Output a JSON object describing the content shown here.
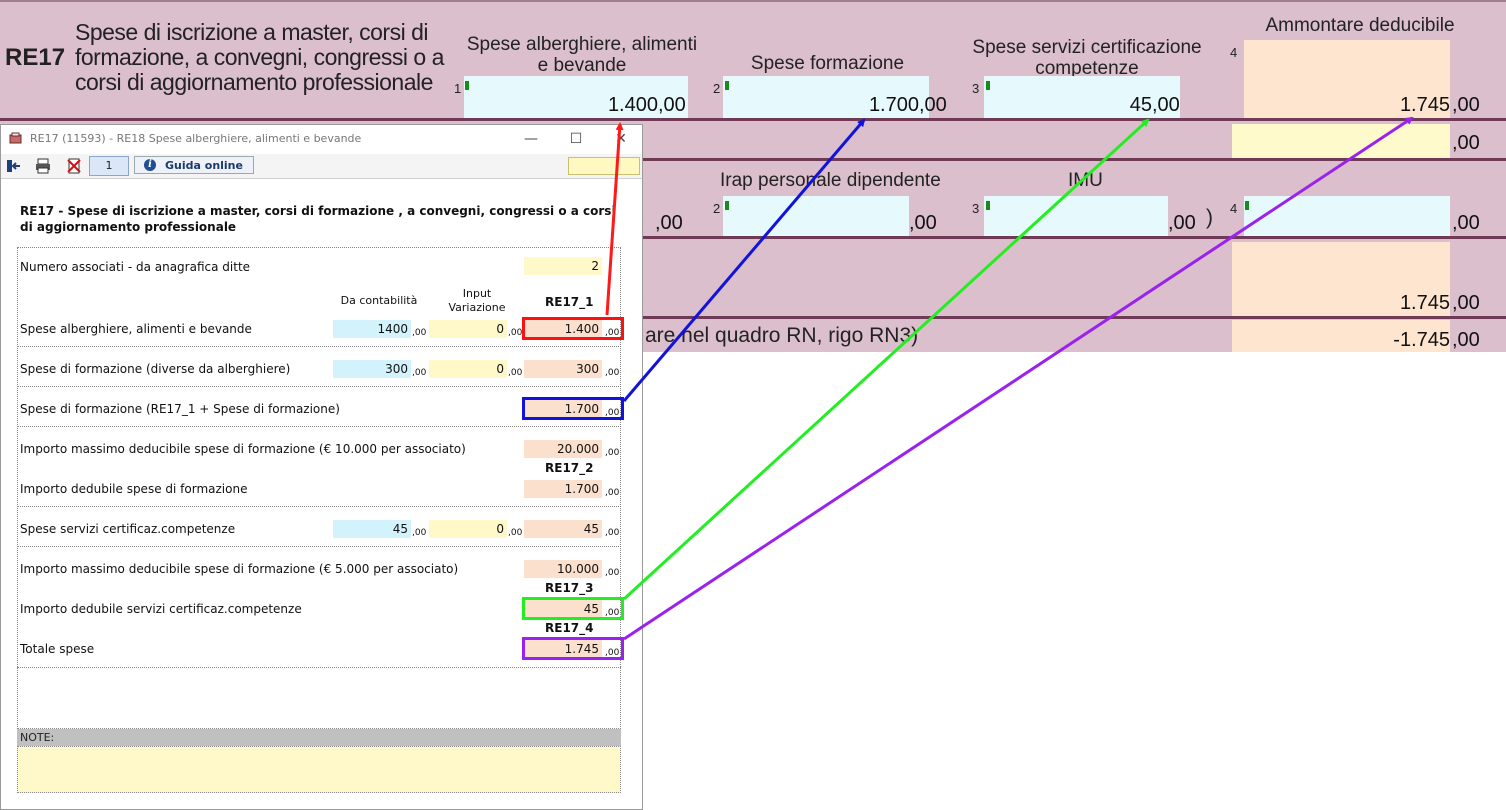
{
  "form": {
    "row_code": "RE17",
    "row_desc": "Spese di iscrizione a master, corsi di formazione, a convegni, congressi o a corsi di aggiornamento professionale",
    "col1_head": "Spese alberghiere, alimenti e bevande",
    "col2_head": "Spese formazione",
    "col3_head": "Spese servizi certificazione competenze",
    "col4_head": "Ammontare deducibile",
    "f1_num": "1",
    "f1_val": "1.400",
    "f1_dec": ",00",
    "f2_num": "2",
    "f2_val": "1.700",
    "f2_dec": ",00",
    "f3_num": "3",
    "f3_val": "45",
    "f3_dec": ",00",
    "f4_num": "4",
    "f4_val": "1.745",
    "f4_dec": ",00",
    "row2_f4_dec": ",00",
    "irap_head": "Irap personale dipendente",
    "imu_head": "IMU",
    "r3_f1_dec": ",00",
    "r3_f2_num": "2",
    "r3_f2_dec": ",00",
    "r3_f3_num": "3",
    "r3_f3_dec": ",00",
    "paren": ")",
    "r3_f4_num": "4",
    "r3_f4_dec": ",00",
    "r4_f4_val": "1.745",
    "r4_f4_dec": ",00",
    "rn_text": "are nel quadro RN, rigo RN3)",
    "r5_f4_val": "-1.745",
    "r5_f4_dec": ",00"
  },
  "window": {
    "title": "RE17 (11593) - RE18 Spese alberghiere, alimenti e bevande",
    "minimize": "—",
    "maximize": "☐",
    "close": "✕"
  },
  "toolbar": {
    "page": "1",
    "guida_label": "Guida online",
    "guida_icon": "i"
  },
  "dialog": {
    "title": "RE17 -  Spese di iscrizione a master, corsi di formazione , a convegni, congressi o a corsi di aggiornamento professionale",
    "numero_label": "Numero associati - da anagrafica ditte",
    "numero_val": "2",
    "hdr_contab": "Da contabilità",
    "hdr_input": "Input Variazione",
    "hdr_re17_1": "RE17_1",
    "hdr_re17_2": "RE17_2",
    "hdr_re17_3": "RE17_3",
    "hdr_re17_4": "RE17_4",
    "dec": ",00",
    "rows": {
      "alb_label": "Spese alberghiere, alimenti e bevande",
      "alb_contab": "1400",
      "alb_var": "0",
      "alb_tot": "1.400",
      "form_label": "Spese di formazione (diverse da alberghiere)",
      "form_contab": "300",
      "form_var": "0",
      "form_tot": "300",
      "formsum_label": "Spese di formazione (RE17_1 + Spese di formazione)",
      "formsum_tot": "1.700",
      "max1_label": "Importo massimo deducibile spese di formazione (€ 10.000 per associato)",
      "max1_tot": "20.000",
      "ded1_label": "Importo dedubile spese di formazione",
      "ded1_tot": "1.700",
      "cert_label": "Spese servizi certificaz.competenze",
      "cert_contab": "45",
      "cert_var": "0",
      "cert_tot": "45",
      "max2_label": "Importo massimo deducibile spese di formazione (€ 5.000 per associato)",
      "max2_tot": "10.000",
      "ded2_label": "Importo dedubile servizi certificaz.competenze",
      "ded2_tot": "45",
      "totale_label": "Totale spese",
      "totale_tot": "1.745"
    },
    "notes_label": "NOTE:"
  },
  "colors": {
    "form_bg": "#dcbfcc",
    "field_cyan": "#e6f9fc",
    "field_peach": "#fde5cf",
    "field_yellow": "#fffacc",
    "arrow_red": "#ff1a1a",
    "arrow_blue": "#1212dd",
    "arrow_green": "#22ee22",
    "arrow_purple": "#9a22ee"
  }
}
